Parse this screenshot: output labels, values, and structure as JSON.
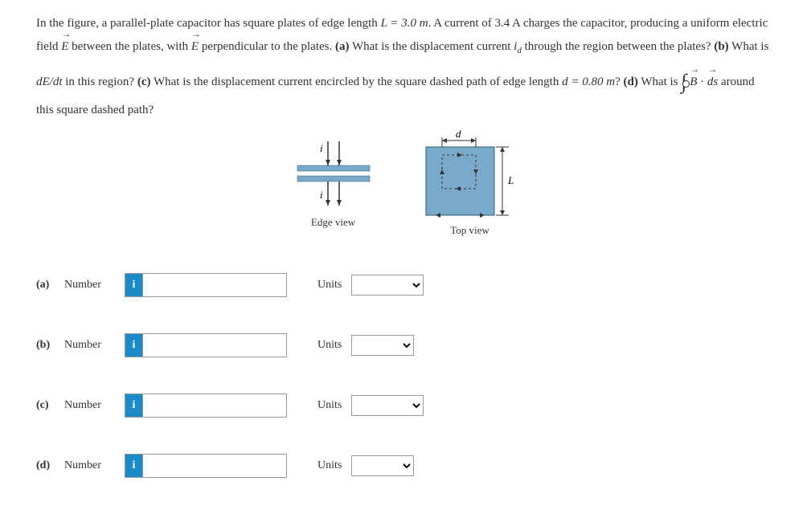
{
  "problem": {
    "p1": "In the figure, a parallel-plate capacitor has square plates of edge length ",
    "L_eq": "L = 3.0 m",
    "p2": ". A current of 3.4 A charges the capacitor, producing a uniform electric field ",
    "E1": "E",
    "p3": " between the plates, with ",
    "E2": "E",
    "p4": " perpendicular to the plates. ",
    "qa_bold": "(a)",
    "qa": " What is the displacement current ",
    "id": "i",
    "id_sub": "d",
    "qa2": " through the region between the plates? ",
    "qb_bold": "(b)",
    "qb": " What is ",
    "dEdt": "dE/dt",
    "qb2": " in this region? ",
    "qc_bold": "(c)",
    "qc": " What is the displacement current encircled by the square dashed path of edge length ",
    "d_eq": "d = 0.80 m",
    "qc2": "? ",
    "qd_bold": "(d)",
    "qd": " What is ",
    "B": "B",
    "dot": " · ",
    "ds": "ds",
    "qd2": " around this square dashed path?"
  },
  "figure": {
    "edge_label": "Edge view",
    "top_label": "Top view",
    "i_label": "i",
    "d_label": "d",
    "L_label": "L"
  },
  "answers": {
    "a": {
      "part": "(a)",
      "number_label": "Number",
      "units_label": "Units"
    },
    "b": {
      "part": "(b)",
      "number_label": "Number",
      "units_label": "Units"
    },
    "c": {
      "part": "(c)",
      "number_label": "Number",
      "units_label": "Units"
    },
    "d": {
      "part": "(d)",
      "number_label": "Number",
      "units_label": "Units"
    }
  },
  "info_symbol": "i"
}
